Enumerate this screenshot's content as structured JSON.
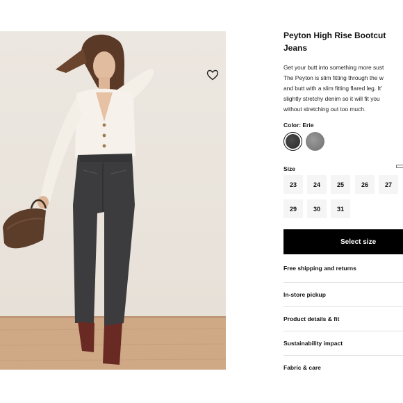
{
  "product": {
    "title": "Peyton High Rise Bootcut Jeans",
    "description_lines": [
      "Get your butt into something more sust",
      "The Peyton is slim fitting through the w",
      "and butt with a slim fitting flared leg. It'",
      "slightly stretchy denim so it will fit you",
      "without stretching out too much."
    ],
    "wishlist_icon": "heart-icon"
  },
  "color": {
    "label": "Color: Erie",
    "swatches": [
      {
        "name": "Erie",
        "hex": "#333333",
        "selected": true
      },
      {
        "name": "Grey",
        "hex": "#8a8a8a",
        "selected": false
      }
    ]
  },
  "size": {
    "label": "Size",
    "guide_icon": "ruler-icon",
    "options": [
      "23",
      "24",
      "25",
      "26",
      "27",
      "29",
      "30",
      "31"
    ]
  },
  "cta": {
    "label": "Select size"
  },
  "accordion": [
    "Free shipping and returns",
    "In-store pickup",
    "Product details & fit",
    "Sustainability impact",
    "Fabric & care"
  ],
  "colors": {
    "cta_bg": "#000000",
    "size_bg": "#f5f5f5",
    "divider": "#e2e2e2"
  }
}
